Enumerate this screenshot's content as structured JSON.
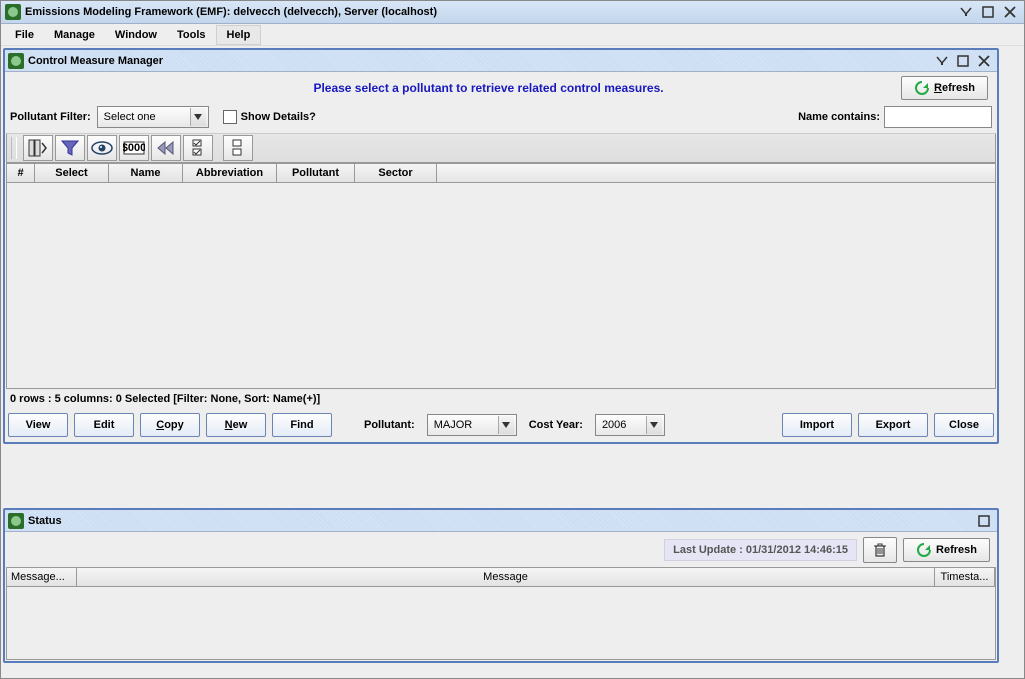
{
  "app_title": "Emissions Modeling Framework (EMF):  delvecch (delvecch),        Server (localhost)",
  "menubar": [
    "File",
    "Manage",
    "Window",
    "Tools",
    "Help"
  ],
  "cmc": {
    "title": "Control Measure Manager",
    "instruction": "Please select a pollutant to retrieve related control measures.",
    "refresh_label": "Refresh",
    "pollutant_filter_label": "Pollutant Filter:",
    "pollutant_filter_value": "Select one",
    "show_details_label": "Show Details?",
    "name_contains_label": "Name contains:",
    "name_contains_value": "",
    "columns": {
      "row_num": "#",
      "select": "Select",
      "name": "Name",
      "abbr": "Abbreviation",
      "pollutant": "Pollutant",
      "sector": "Sector"
    },
    "status_bar": "0 rows : 5 columns: 0 Selected [Filter: None, Sort: Name(+)]",
    "buttons": {
      "view": "View",
      "edit": "Edit",
      "copy": "Copy",
      "new": "New",
      "find": "Find",
      "import": "Import",
      "export": "Export",
      "close": "Close"
    },
    "pollutant_label": "Pollutant:",
    "pollutant_value": "MAJOR",
    "cost_year_label": "Cost Year:",
    "cost_year_value": "2006"
  },
  "status": {
    "title": "Status",
    "last_update": "Last Update : 01/31/2012 14:46:15",
    "refresh_label": "Refresh",
    "columns": {
      "msg_short": "Message...",
      "msg": "Message",
      "timestamp": "Timesta..."
    }
  }
}
